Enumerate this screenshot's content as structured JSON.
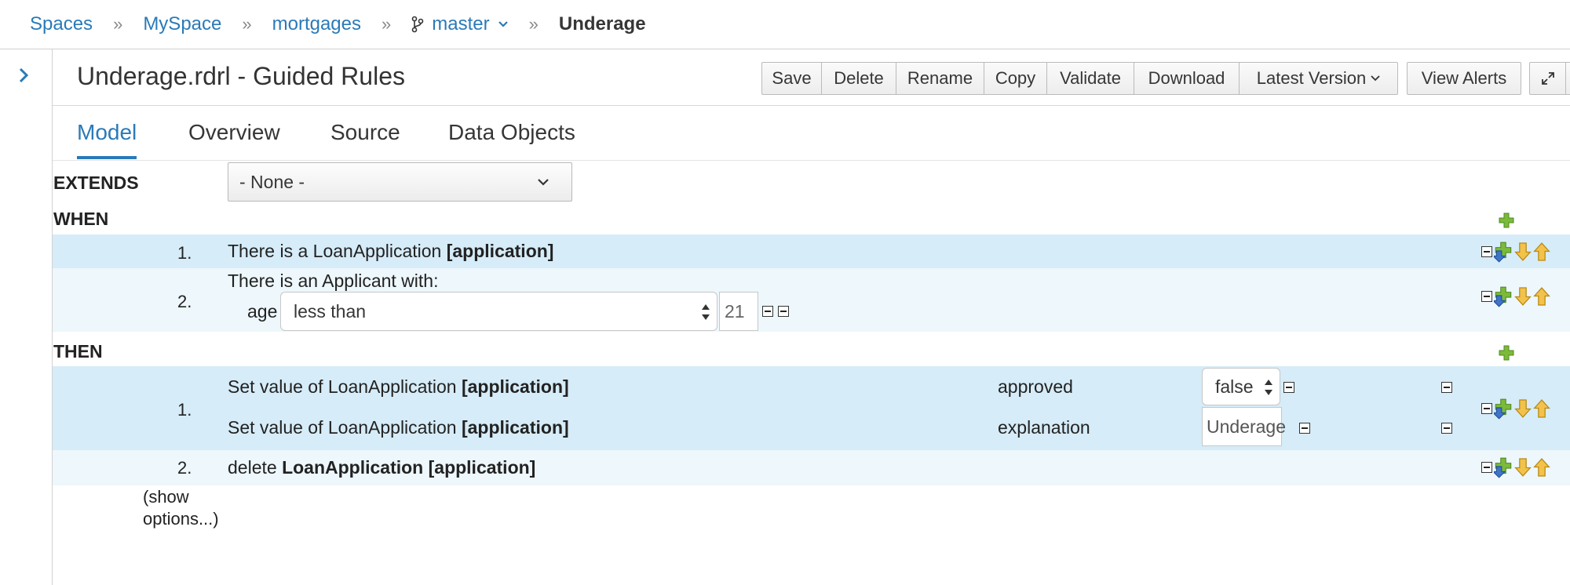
{
  "breadcrumb": {
    "items": [
      "Spaces",
      "MySpace",
      "mortgages"
    ],
    "branch": "master",
    "current": "Underage"
  },
  "editor": {
    "title": "Underage.rdrl - Guided Rules",
    "toolbar": {
      "save": "Save",
      "delete": "Delete",
      "rename": "Rename",
      "copy": "Copy",
      "validate": "Validate",
      "download": "Download",
      "latest_version": "Latest Version",
      "view_alerts": "View Alerts"
    },
    "tabs": [
      "Model",
      "Overview",
      "Source",
      "Data Objects"
    ]
  },
  "rule": {
    "extends_label": "EXTENDS",
    "extends_value": "- None -",
    "when_label": "WHEN",
    "then_label": "THEN",
    "when": [
      {
        "num": "1.",
        "prefix": "There is a LoanApplication ",
        "binding": "[application]"
      },
      {
        "num": "2.",
        "text": "There is an Applicant with:",
        "field": "age",
        "operator": "less than",
        "value": "21"
      }
    ],
    "then": [
      {
        "num": "1.",
        "line1_prefix": "Set value of LoanApplication ",
        "line1_binding": "[application]",
        "line1_field": "approved",
        "line1_value": "false",
        "line2_prefix": "Set value of LoanApplication ",
        "line2_binding": "[application]",
        "line2_field": "explanation",
        "line2_value": "Underage"
      },
      {
        "num": "2.",
        "prefix": "delete ",
        "bold": "LoanApplication [application]"
      }
    ],
    "show_options_1": "(show",
    "show_options_2": "options...)"
  },
  "colors": {
    "link": "#2a7ab8",
    "row_blue": "#d6ecf8",
    "row_light": "#edf7fc"
  }
}
